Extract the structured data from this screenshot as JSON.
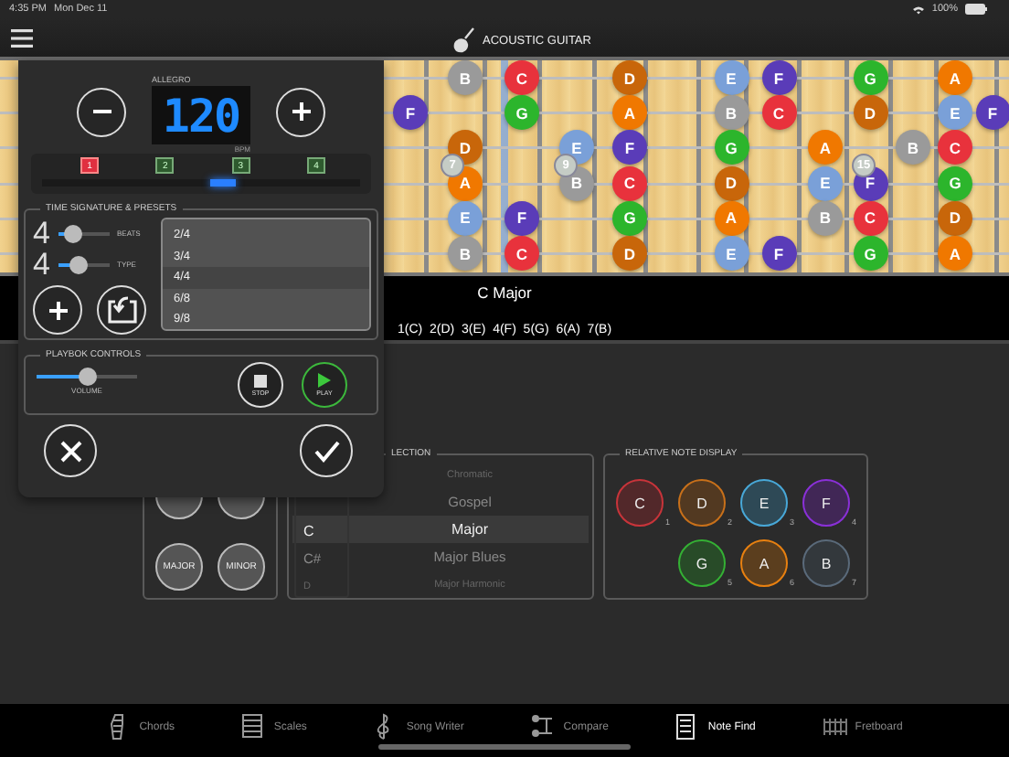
{
  "status_bar": {
    "time": "4:35 PM",
    "date": "Mon Dec 11",
    "battery": "100%"
  },
  "header": {
    "title": "ACOUSTIC GUITAR"
  },
  "fretboard": {
    "strings": [
      {
        "slots": [
          {
            "kind": "gap"
          },
          {
            "kind": "note",
            "note": "B",
            "color": "#9a9a9a"
          },
          {
            "kind": "note",
            "note": "C",
            "color": "#e8323c"
          },
          {
            "kind": "gap"
          },
          {
            "kind": "note",
            "note": "D",
            "color": "#c8660a"
          },
          {
            "kind": "gap"
          },
          {
            "kind": "note",
            "note": "E",
            "color": "#7aa0d8"
          },
          {
            "kind": "note",
            "note": "F",
            "color": "#5a3cb8"
          },
          {
            "kind": "gap"
          },
          {
            "kind": "note",
            "note": "G",
            "color": "#2cb52c"
          },
          {
            "kind": "gap"
          },
          {
            "kind": "note",
            "note": "A",
            "color": "#f07800"
          },
          {
            "kind": "gap"
          }
        ]
      },
      {
        "slots": [
          {
            "kind": "note",
            "note": "F",
            "color": "#5a3cb8"
          },
          {
            "kind": "gap"
          },
          {
            "kind": "note",
            "note": "G",
            "color": "#2cb52c"
          },
          {
            "kind": "gap"
          },
          {
            "kind": "note",
            "note": "A",
            "color": "#f07800"
          },
          {
            "kind": "gap"
          },
          {
            "kind": "note",
            "note": "B",
            "color": "#9a9a9a"
          },
          {
            "kind": "note",
            "note": "C",
            "color": "#e8323c"
          },
          {
            "kind": "gap"
          },
          {
            "kind": "note",
            "note": "D",
            "color": "#c8660a"
          },
          {
            "kind": "gap"
          },
          {
            "kind": "note",
            "note": "E",
            "color": "#7aa0d8"
          },
          {
            "kind": "note",
            "note": "F",
            "color": "#5a3cb8"
          }
        ]
      },
      {
        "slots": [
          {
            "kind": "gap"
          },
          {
            "kind": "note",
            "note": "D",
            "color": "#c8660a"
          },
          {
            "kind": "gap"
          },
          {
            "kind": "note",
            "note": "E",
            "color": "#7aa0d8"
          },
          {
            "kind": "note",
            "note": "F",
            "color": "#5a3cb8"
          },
          {
            "kind": "gap"
          },
          {
            "kind": "note",
            "note": "G",
            "color": "#2cb52c"
          },
          {
            "kind": "gap"
          },
          {
            "kind": "note",
            "note": "A",
            "color": "#f07800"
          },
          {
            "kind": "gap"
          },
          {
            "kind": "note",
            "note": "B",
            "color": "#9a9a9a"
          },
          {
            "kind": "note",
            "note": "C",
            "color": "#e8323c"
          },
          {
            "kind": "gap"
          }
        ]
      },
      {
        "slots": [
          {
            "kind": "gap"
          },
          {
            "kind": "note",
            "note": "A",
            "color": "#f07800"
          },
          {
            "kind": "gap"
          },
          {
            "kind": "note",
            "note": "B",
            "color": "#9a9a9a"
          },
          {
            "kind": "note",
            "note": "C",
            "color": "#e8323c"
          },
          {
            "kind": "gap"
          },
          {
            "kind": "note",
            "note": "D",
            "color": "#c8660a"
          },
          {
            "kind": "gap"
          },
          {
            "kind": "note",
            "note": "E",
            "color": "#7aa0d8"
          },
          {
            "kind": "note",
            "note": "F",
            "color": "#5a3cb8"
          },
          {
            "kind": "gap"
          },
          {
            "kind": "note",
            "note": "G",
            "color": "#2cb52c"
          },
          {
            "kind": "gap"
          }
        ]
      },
      {
        "slots": [
          {
            "kind": "gap"
          },
          {
            "kind": "note",
            "note": "E",
            "color": "#7aa0d8"
          },
          {
            "kind": "note",
            "note": "F",
            "color": "#5a3cb8"
          },
          {
            "kind": "gap"
          },
          {
            "kind": "note",
            "note": "G",
            "color": "#2cb52c"
          },
          {
            "kind": "gap"
          },
          {
            "kind": "note",
            "note": "A",
            "color": "#f07800"
          },
          {
            "kind": "gap"
          },
          {
            "kind": "note",
            "note": "B",
            "color": "#9a9a9a"
          },
          {
            "kind": "note",
            "note": "C",
            "color": "#e8323c"
          },
          {
            "kind": "gap"
          },
          {
            "kind": "note",
            "note": "D",
            "color": "#c8660a"
          },
          {
            "kind": "gap"
          }
        ]
      },
      {
        "slots": [
          {
            "kind": "gap"
          },
          {
            "kind": "note",
            "note": "B",
            "color": "#9a9a9a"
          },
          {
            "kind": "note",
            "note": "C",
            "color": "#e8323c"
          },
          {
            "kind": "gap"
          },
          {
            "kind": "note",
            "note": "D",
            "color": "#c8660a"
          },
          {
            "kind": "gap"
          },
          {
            "kind": "note",
            "note": "E",
            "color": "#7aa0d8"
          },
          {
            "kind": "note",
            "note": "F",
            "color": "#5a3cb8"
          },
          {
            "kind": "gap"
          },
          {
            "kind": "note",
            "note": "G",
            "color": "#2cb52c"
          },
          {
            "kind": "gap"
          },
          {
            "kind": "note",
            "note": "A",
            "color": "#f07800"
          },
          {
            "kind": "gap"
          }
        ]
      }
    ],
    "fret_markers": [
      {
        "kind": "gap"
      },
      {
        "kind": "marker",
        "label": "7"
      },
      {
        "kind": "gap"
      },
      {
        "kind": "marker",
        "label": "9"
      },
      {
        "kind": "gap"
      },
      {
        "kind": "gap"
      },
      {
        "kind": "gap"
      },
      {
        "kind": "gap"
      },
      {
        "kind": "gap"
      },
      {
        "kind": "marker",
        "label": "15"
      },
      {
        "kind": "gap"
      },
      {
        "kind": "gap"
      },
      {
        "kind": "gap"
      }
    ]
  },
  "scale_info": {
    "name": "C Major",
    "intervals": "1(C)  2(D)  3(E)  4(F)  5(G)  6(A)  7(B)"
  },
  "chord_types": [
    {
      "label": "MAJOR"
    },
    {
      "label": "MINOR"
    }
  ],
  "scale_selection": {
    "title": "LECTION",
    "roots": [
      {
        "label": "C",
        "selected": true
      },
      {
        "label": "C#",
        "selected": false
      },
      {
        "label": "D",
        "selected": false
      }
    ],
    "scales": [
      {
        "label": "Chromatic",
        "selected": false
      },
      {
        "label": "Gospel",
        "selected": false
      },
      {
        "label": "Major",
        "selected": true
      },
      {
        "label": "Major Blues",
        "selected": false
      },
      {
        "label": "Major Harmonic",
        "selected": false
      }
    ]
  },
  "relative_notes": {
    "title": "RELATIVE NOTE DISPLAY",
    "notes": [
      {
        "label": "C",
        "degree": "1",
        "color": "#c8343a"
      },
      {
        "label": "D",
        "degree": "2",
        "color": "#c8701a"
      },
      {
        "label": "E",
        "degree": "3",
        "color": "#48a8d8"
      },
      {
        "label": "F",
        "degree": "4",
        "color": "#8a30d8"
      },
      {
        "label": "G",
        "degree": "5",
        "color": "#34b034"
      },
      {
        "label": "A",
        "degree": "6",
        "color": "#e88010"
      },
      {
        "label": "B",
        "degree": "7",
        "color": "#5a6a7a"
      }
    ]
  },
  "metronome": {
    "tempo_name": "ALLEGRO",
    "tempo": "120",
    "unit": "BPM",
    "beats": [
      {
        "label": "1",
        "on": true
      },
      {
        "label": "2",
        "on": false
      },
      {
        "label": "3",
        "on": false
      },
      {
        "label": "4",
        "on": false
      }
    ],
    "time_signature": {
      "title": "TIME SIGNATURE & PRESETS",
      "beats": {
        "value": "4",
        "label": "BEATS",
        "level": 0.3
      },
      "type": {
        "value": "4",
        "label": "TYPE",
        "level": 0.4
      },
      "presets": [
        {
          "label": "2/4",
          "selected": false
        },
        {
          "label": "3/4",
          "selected": false
        },
        {
          "label": "4/4",
          "selected": true
        },
        {
          "label": "6/8",
          "selected": false
        },
        {
          "label": "9/8",
          "selected": false
        }
      ]
    },
    "playback": {
      "title": "PLAYBOK CONTROLS",
      "volume": {
        "label": "VOLUME",
        "level": 0.5
      },
      "stop": "STOP",
      "play": "PLAY"
    }
  },
  "tabs": [
    {
      "label": "Chords",
      "selected": false
    },
    {
      "label": "Scales",
      "selected": false
    },
    {
      "label": "Song Writer",
      "selected": false
    },
    {
      "label": "Compare",
      "selected": false
    },
    {
      "label": "Note Find",
      "selected": true
    },
    {
      "label": "Fretboard",
      "selected": false
    }
  ]
}
